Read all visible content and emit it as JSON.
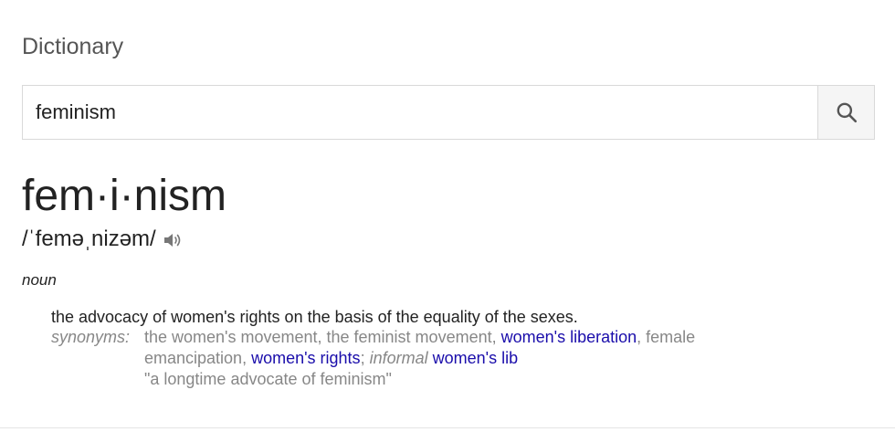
{
  "card": {
    "title": "Dictionary"
  },
  "search": {
    "value": "feminism",
    "button_icon": "search-icon"
  },
  "entry": {
    "headword": "fem·i·nism",
    "pronunciation": "/ˈfeməˌnizəm/",
    "audio_icon": "speaker-icon",
    "part_of_speech": "noun",
    "definition": "the advocacy of women's rights on the basis of the equality of the sexes.",
    "synonyms_label": "synonyms:",
    "synonyms": {
      "plain_1": "the women's movement, the feminist movement, ",
      "link_1": "women's liberation",
      "plain_2": ", female emancipation, ",
      "link_2": "women's rights",
      "plain_3": "; ",
      "register": "informal",
      "plain_4": " ",
      "link_3": "women's lib"
    },
    "example": "\"a longtime advocate of feminism\""
  },
  "colors": {
    "link": "#1a0dab",
    "muted_text": "#878787",
    "title_text": "#555555"
  }
}
